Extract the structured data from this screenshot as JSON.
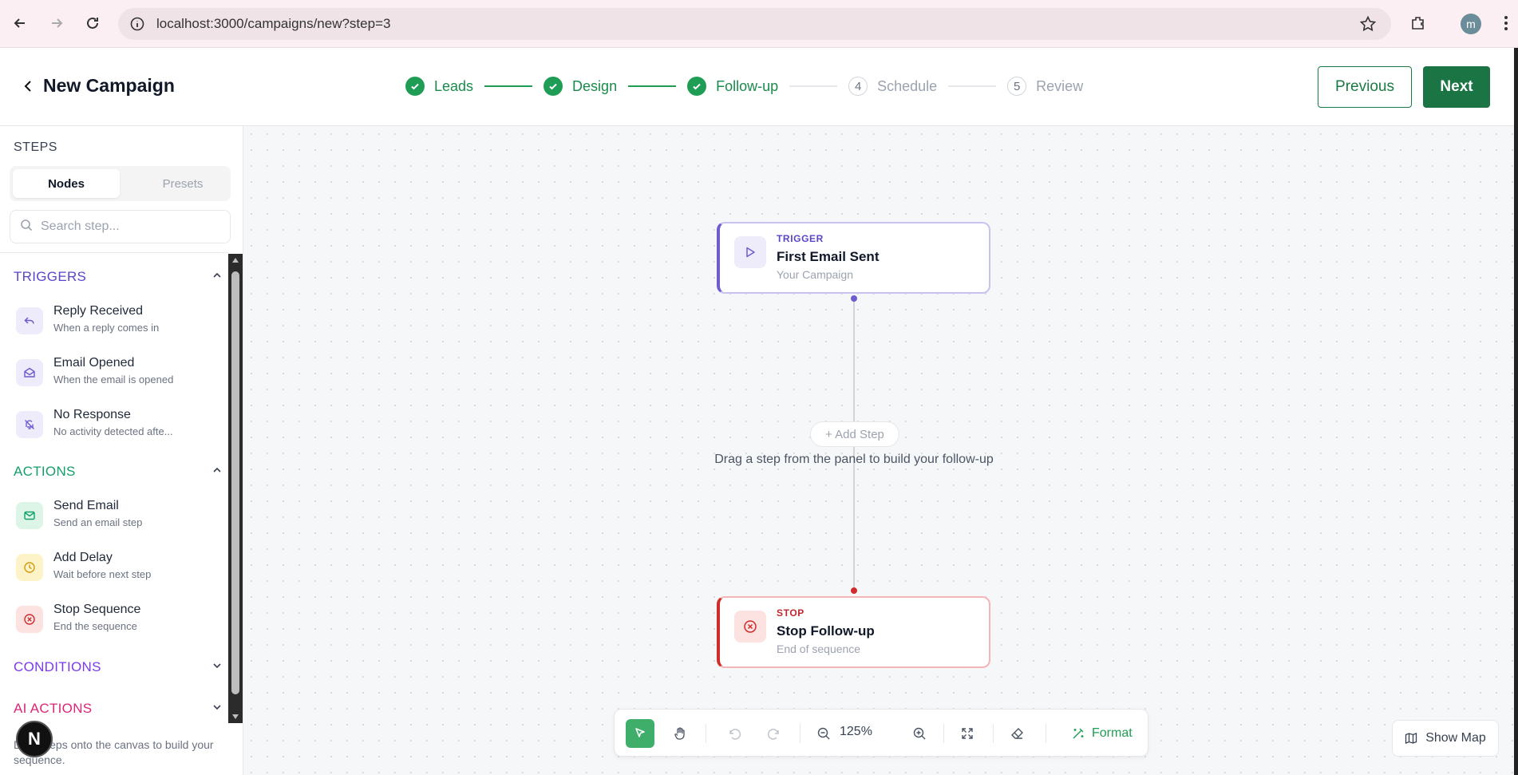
{
  "browser": {
    "url": "localhost:3000/campaigns/new?step=3",
    "profile_initial": "m"
  },
  "header": {
    "title": "New Campaign",
    "steps": [
      {
        "number": "1",
        "label": "Leads",
        "status": "done"
      },
      {
        "number": "2",
        "label": "Design",
        "status": "done"
      },
      {
        "number": "3",
        "label": "Follow-up",
        "status": "done"
      },
      {
        "number": "4",
        "label": "Schedule",
        "status": "todo"
      },
      {
        "number": "5",
        "label": "Review",
        "status": "todo"
      }
    ],
    "previous_label": "Previous",
    "next_label": "Next"
  },
  "sidebar": {
    "title": "STEPS",
    "tabs": [
      "Nodes",
      "Presets"
    ],
    "active_tab": "Nodes",
    "search_placeholder": "Search step...",
    "sections": [
      {
        "title": "TRIGGERS",
        "color": "#5b45c9",
        "expanded": true,
        "items": [
          {
            "title": "Reply Received",
            "subtitle": "When a reply comes in",
            "icon": "reply-icon"
          },
          {
            "title": "Email Opened",
            "subtitle": "When the email is opened",
            "icon": "mail-open-icon"
          },
          {
            "title": "No Response",
            "subtitle": "No activity detected afte...",
            "icon": "bell-off-icon"
          }
        ]
      },
      {
        "title": "ACTIONS",
        "color": "#13a06a",
        "expanded": true,
        "items": [
          {
            "title": "Send Email",
            "subtitle": "Send an email step",
            "icon": "mail-icon"
          },
          {
            "title": "Add Delay",
            "subtitle": "Wait before next step",
            "icon": "clock-icon"
          },
          {
            "title": "Stop Sequence",
            "subtitle": "End the sequence",
            "icon": "stop-circle-icon"
          }
        ]
      },
      {
        "title": "CONDITIONS",
        "color": "#7c3aed",
        "expanded": false,
        "items": []
      },
      {
        "title": "AI ACTIONS",
        "color": "#db2777",
        "expanded": false,
        "items": []
      }
    ],
    "footer_hint": "Drag steps onto the canvas to build your sequence."
  },
  "canvas": {
    "trigger_node": {
      "kicker": "TRIGGER",
      "title": "First Email Sent",
      "subtitle": "Your Campaign"
    },
    "stop_node": {
      "kicker": "STOP",
      "title": "Stop Follow-up",
      "subtitle": "End of sequence"
    },
    "add_step_label": "+ Add Step",
    "drag_hint": "Drag a step from the panel to build your follow-up",
    "zoom": "125%",
    "format_label": "Format",
    "show_map_label": "Show Map"
  },
  "colors": {
    "brand_green": "#1a7444",
    "trigger_purple": "#6d5bd0",
    "stop_red": "#d12c2c"
  }
}
